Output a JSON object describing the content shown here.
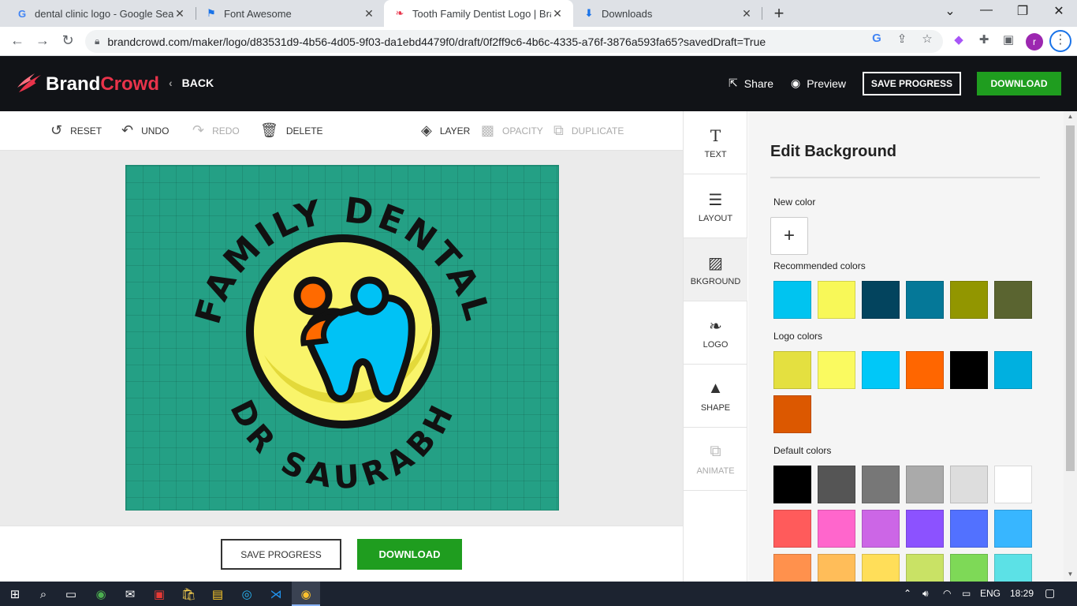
{
  "browser": {
    "tabs": [
      {
        "title": "dental clinic logo - Google Search",
        "favicon": "google-icon",
        "active": false
      },
      {
        "title": "Font Awesome",
        "favicon": "flag-icon",
        "active": false
      },
      {
        "title": "Tooth Family Dentist Logo | BrandCrowd",
        "favicon": "brandcrowd-icon",
        "active": true
      },
      {
        "title": "Downloads",
        "favicon": "download-icon",
        "active": false
      }
    ],
    "url": "brandcrowd.com/maker/logo/d83531d9-4b56-4d05-9f03-da1ebd4479f0/draft/0f2ff9c6-4b6c-4335-a76f-3876a593fa65?savedDraft=True",
    "profile_initial": "r"
  },
  "header": {
    "brand_part1": "Brand",
    "brand_part2": "Crowd",
    "back_label": "BACK",
    "share_label": "Share",
    "preview_label": "Preview",
    "save_label": "SAVE PROGRESS",
    "download_label": "DOWNLOAD"
  },
  "toolbar": {
    "reset": "RESET",
    "undo": "UNDO",
    "redo": "REDO",
    "delete": "DELETE",
    "layer": "LAYER",
    "opacity": "OPACITY",
    "duplicate": "DUPLICATE"
  },
  "logo": {
    "top_text": "FAMILY DENTAL",
    "bottom_text": "DR SAURABH",
    "bg_color": "#24a085"
  },
  "bottom": {
    "save_label": "SAVE PROGRESS",
    "download_label": "DOWNLOAD"
  },
  "rail": [
    {
      "label": "TEXT",
      "icon": "text-icon"
    },
    {
      "label": "LAYOUT",
      "icon": "layout-icon"
    },
    {
      "label": "BKGROUND",
      "icon": "background-icon"
    },
    {
      "label": "LOGO",
      "icon": "logo-icon"
    },
    {
      "label": "SHAPE",
      "icon": "shape-icon"
    },
    {
      "label": "ANIMATE",
      "icon": "animate-icon"
    }
  ],
  "panel": {
    "title": "Edit Background",
    "new_color_label": "New color",
    "recommended_label": "Recommended colors",
    "recommended": [
      "#00c4f0",
      "#f8f858",
      "#03445e",
      "#057898",
      "#929600",
      "#5a6430"
    ],
    "logo_colors_label": "Logo colors",
    "logo_colors": [
      "#e4e040",
      "#fafa60",
      "#00c8f8",
      "#ff6600",
      "#000000",
      "#00b0e0",
      "#dc5800"
    ],
    "default_label": "Default colors",
    "default_colors": [
      "#000000",
      "#555555",
      "#777777",
      "#aaaaaa",
      "#dddddd",
      "#ffffff",
      "#ff5b5b",
      "#ff66cc",
      "#cc66e6",
      "#8c52ff",
      "#5271ff",
      "#38b6ff",
      "#ff914d",
      "#ffbd59",
      "#ffde59",
      "#c9e265",
      "#7ed957",
      "#5ce1e6"
    ]
  },
  "taskbar": {
    "lang": "ENG",
    "time": "18:29"
  }
}
